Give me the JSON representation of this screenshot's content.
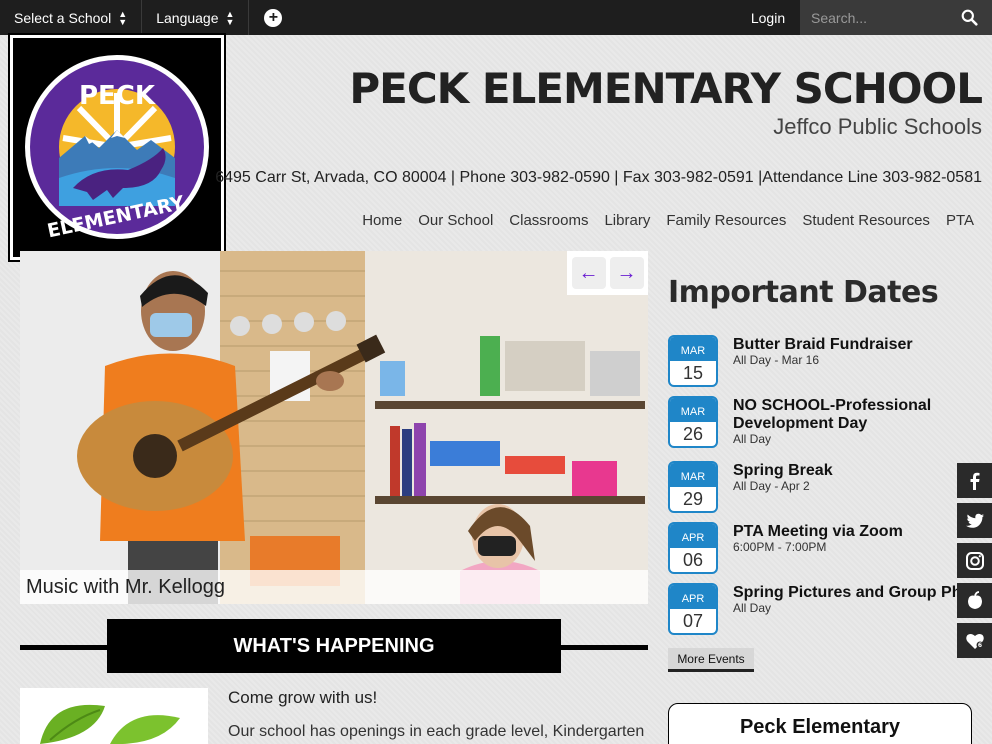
{
  "topbar": {
    "select_school": "Select a School",
    "language": "Language",
    "login": "Login",
    "search_placeholder": "Search..."
  },
  "logo": {
    "top_text": "PECK",
    "bottom_text": "ELEMENTARY"
  },
  "header": {
    "title": "PECK ELEMENTARY SCHOOL",
    "district": "Jeffco Public Schools",
    "address": "6495 Carr St, Arvada, CO 80004 | Phone 303-982-0590 | Fax 303-982-0591 |Attendance Line 303-982-0581"
  },
  "nav": {
    "items": [
      "Home",
      "Our School",
      "Classrooms",
      "Library",
      "Family Resources",
      "Student Resources",
      "PTA"
    ]
  },
  "slideshow": {
    "caption": "Music with Mr. Kellogg",
    "prev_icon": "arrow-left-icon",
    "next_icon": "arrow-right-icon"
  },
  "whats_happening": {
    "heading": "WHAT'S HAPPENING",
    "title": "Come grow with us!",
    "text": "Our school has openings in each grade level, Kindergarten"
  },
  "dates": {
    "heading": "Important Dates",
    "events": [
      {
        "month": "MAR",
        "day": "15",
        "title": "Butter Braid Fundraiser",
        "sub": "All Day - Mar 16"
      },
      {
        "month": "MAR",
        "day": "26",
        "title": "NO SCHOOL-Professional Development Day",
        "sub": "All Day"
      },
      {
        "month": "MAR",
        "day": "29",
        "title": "Spring Break",
        "sub": "All Day - Apr 2"
      },
      {
        "month": "APR",
        "day": "06",
        "title": "PTA Meeting via Zoom",
        "sub": "6:00PM - 7:00PM"
      },
      {
        "month": "APR",
        "day": "07",
        "title": "Spring Pictures and Group Photos",
        "sub": "All Day"
      }
    ],
    "more_label": "More Events"
  },
  "info_card": {
    "title": "Peck Elementary"
  },
  "social": [
    "facebook-icon",
    "twitter-icon",
    "instagram-icon",
    "peachjar-icon",
    "heart-icon"
  ],
  "colors": {
    "accent_blue": "#1f86c8",
    "arrow_purple": "#6a1fd1",
    "topbar": "#1e1e1e"
  }
}
